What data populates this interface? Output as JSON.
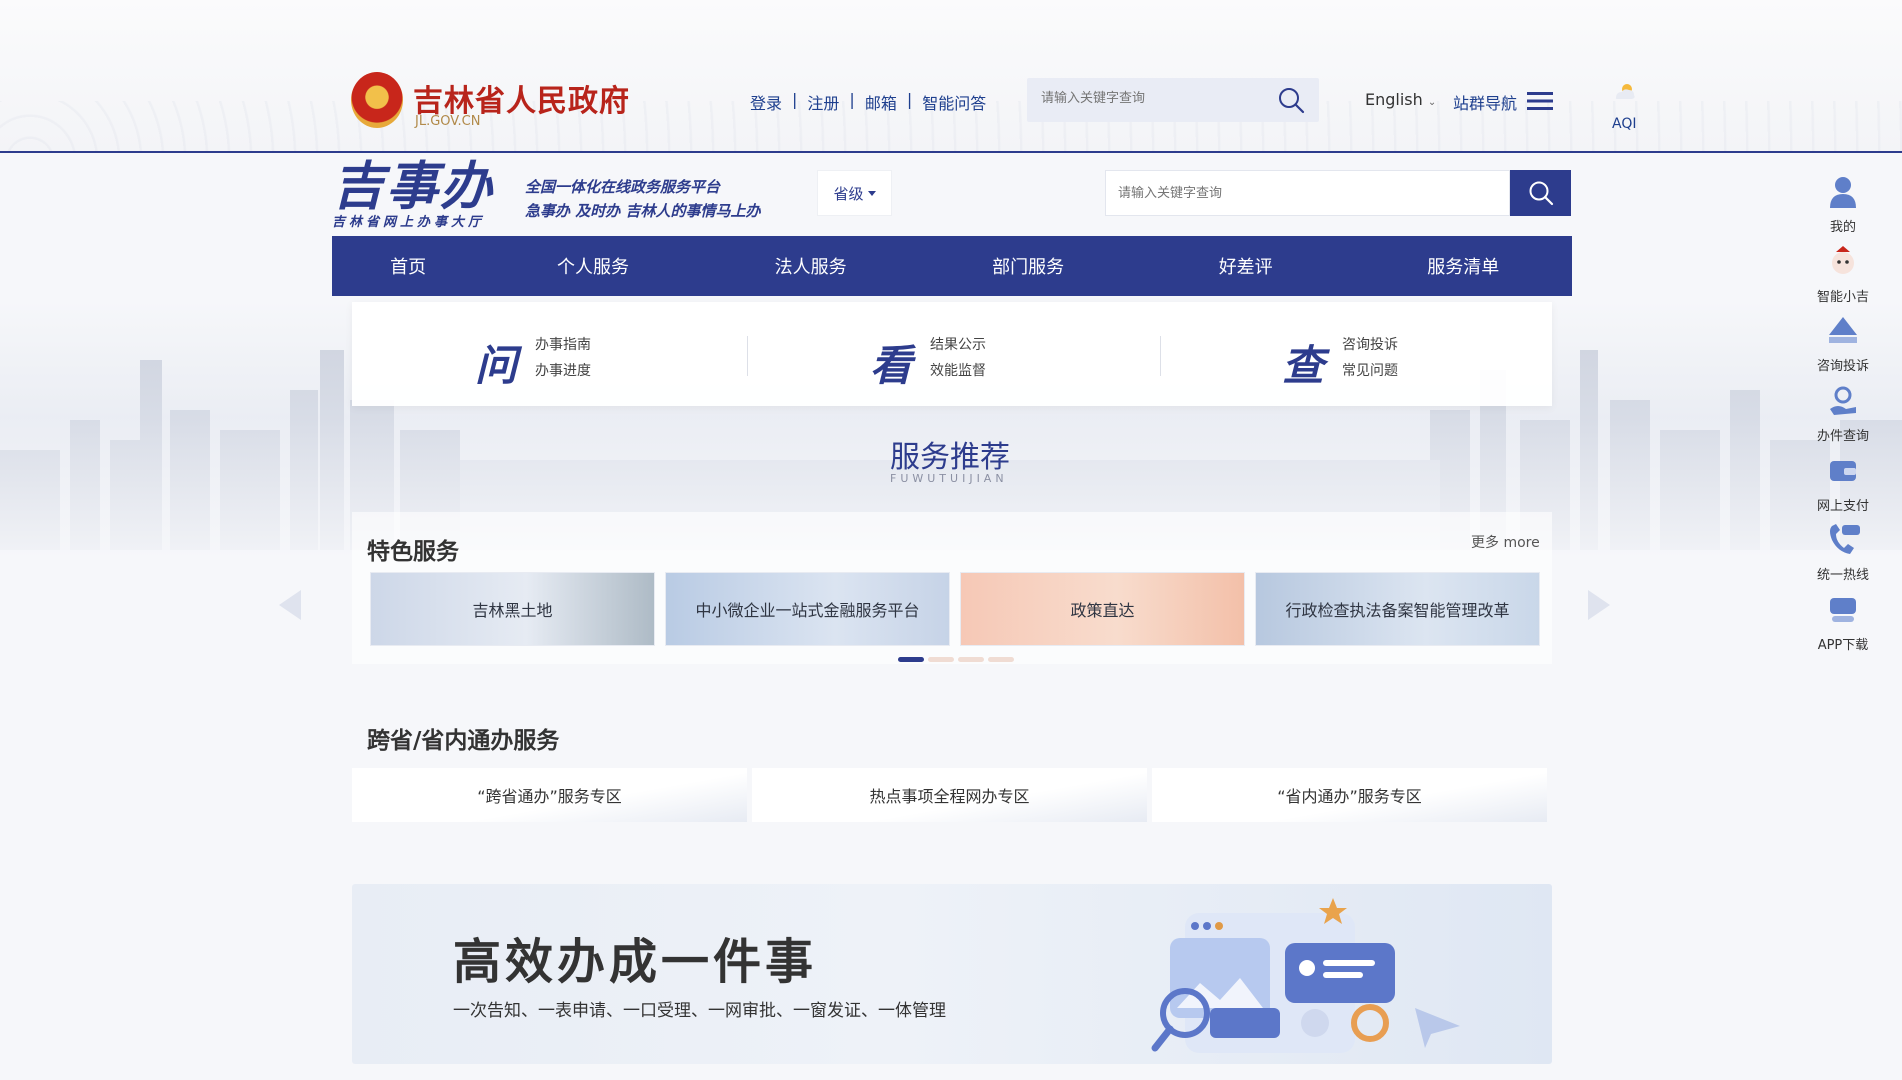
{
  "header": {
    "site_title": "吉林省人民政府",
    "site_domain": "JL.GOV.CN",
    "links": [
      "登录",
      "注册",
      "邮箱",
      "智能问答"
    ],
    "link_separator": "|",
    "search_placeholder": "请输入关键字查询",
    "language": "English",
    "site_nav": "站群导航",
    "aqi": "AQI"
  },
  "portal": {
    "logo_main": "吉事办",
    "logo_sub": "吉林省网上办事大厅",
    "slogan_line1": "全国一体化在线政务服务平台",
    "slogan_line2": "急事办 及时办 吉林人的事情马上办",
    "level": "省级",
    "search_placeholder": "请输入关键字查询",
    "nav": [
      "首页",
      "个人服务",
      "法人服务",
      "部门服务",
      "好差评",
      "服务清单"
    ]
  },
  "quick": [
    {
      "glyph": "问",
      "links": [
        "办事指南",
        "办事进度"
      ]
    },
    {
      "glyph": "看",
      "links": [
        "结果公示",
        "效能监督"
      ]
    },
    {
      "glyph": "查",
      "links": [
        "咨询投诉",
        "常见问题"
      ]
    }
  ],
  "recommend": {
    "title": "服务推荐",
    "subtitle": "FUWUTUIJIAN"
  },
  "featured": {
    "title": "特色服务",
    "more": "更多 more",
    "cards": [
      "吉林黑土地",
      "中小微企业一站式金融服务平台",
      "政策直达",
      "行政检查执法备案智能管理改革"
    ]
  },
  "cross": {
    "title": "跨省/省内通办服务",
    "cards": [
      "“跨省通办”服务专区",
      "热点事项全程网办专区",
      "“省内通办”服务专区"
    ]
  },
  "one_thing": {
    "title": "高效办成一件事",
    "subtitle": "一次告知、一表申请、一口受理、一网审批、一窗发证、一体管理"
  },
  "sidebar": [
    "我的",
    "智能小吉",
    "咨询投诉",
    "办件查询",
    "网上支付",
    "统一热线",
    "APP下载"
  ],
  "icons": {
    "search": "search-icon",
    "menu": "menu-icon",
    "aqi": "weather-icon"
  },
  "colors": {
    "primary": "#2d3c8d",
    "title_red": "#b8241b"
  }
}
